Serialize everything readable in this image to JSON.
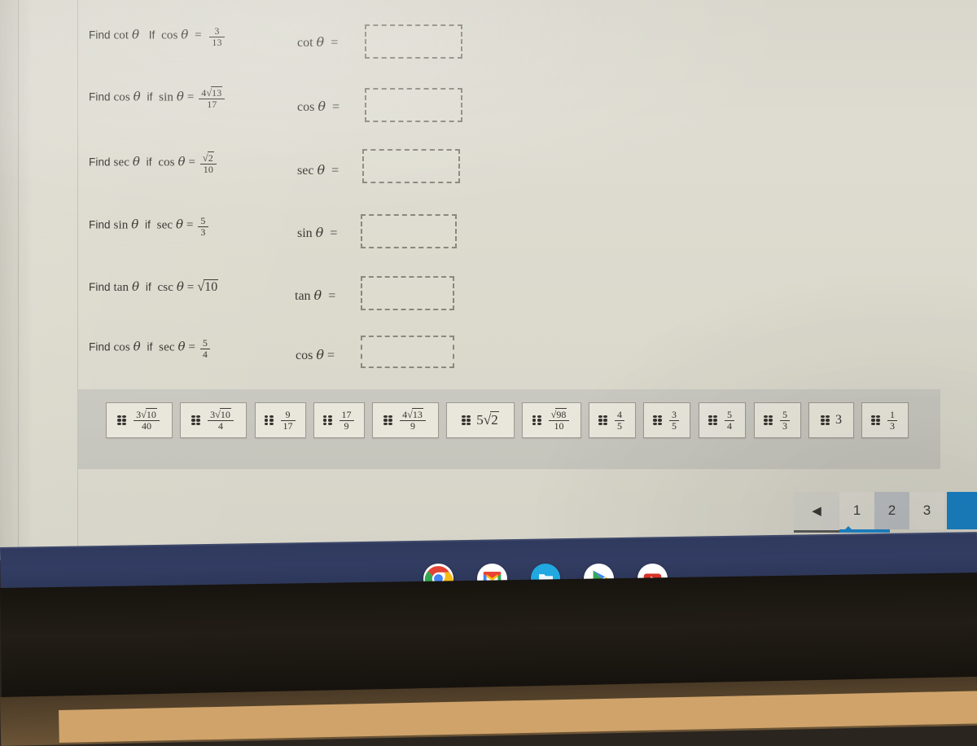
{
  "worksheet": {
    "problems": [
      {
        "prompt_find": "Find cot θ",
        "prompt_if": "If",
        "prompt_given_fn": "cos θ =",
        "given_value": "3/13",
        "answer_label": "cot θ  =",
        "answer_value": ""
      },
      {
        "prompt_find": "Find cos θ",
        "prompt_if": "if",
        "prompt_given_fn": "sin θ =",
        "given_value": "4√13/17",
        "answer_label": "cos θ  =",
        "answer_value": ""
      },
      {
        "prompt_find": "Find sec θ",
        "prompt_if": "if",
        "prompt_given_fn": "cos θ =",
        "given_value": "√2/10",
        "answer_label": "sec θ  =",
        "answer_value": ""
      },
      {
        "prompt_find": "Find sin θ",
        "prompt_if": "if",
        "prompt_given_fn": "sec θ =",
        "given_value": "5/3",
        "answer_label": "sin θ  =",
        "answer_value": ""
      },
      {
        "prompt_find": "Find tan θ",
        "prompt_if": "if",
        "prompt_given_fn": "csc θ =",
        "given_value": "√10",
        "answer_label": "tan θ  =",
        "answer_value": ""
      },
      {
        "prompt_find": "Find cos θ",
        "prompt_if": "if",
        "prompt_given_fn": "sec θ =",
        "given_value": "5/4",
        "answer_label": "cos θ =",
        "answer_value": ""
      }
    ]
  },
  "answer_bank": {
    "tiles": [
      {
        "value": "3√10/40",
        "kind": "fraction",
        "num": "3√10",
        "den": "40"
      },
      {
        "value": "3√10/4",
        "kind": "fraction",
        "num": "3√10",
        "den": "4"
      },
      {
        "value": "9/17",
        "kind": "fraction",
        "num": "9",
        "den": "17"
      },
      {
        "value": "17/9",
        "kind": "fraction",
        "num": "17",
        "den": "9"
      },
      {
        "value": "4√13/9",
        "kind": "fraction",
        "num": "4√13",
        "den": "9"
      },
      {
        "value": "5√2",
        "kind": "plain",
        "num": "5√2",
        "den": ""
      },
      {
        "value": "√98/10",
        "kind": "fraction",
        "num": "√98",
        "den": "10"
      },
      {
        "value": "4/5",
        "kind": "fraction",
        "num": "4",
        "den": "5"
      },
      {
        "value": "3/5",
        "kind": "fraction",
        "num": "3",
        "den": "5"
      },
      {
        "value": "5/4",
        "kind": "fraction",
        "num": "5",
        "den": "4"
      },
      {
        "value": "5/3",
        "kind": "fraction",
        "num": "5",
        "den": "3"
      },
      {
        "value": "3",
        "kind": "plain",
        "num": "3",
        "den": ""
      },
      {
        "value": "1/3",
        "kind": "fraction",
        "num": "1",
        "den": "3"
      }
    ]
  },
  "pagination": {
    "prev_glyph": "◀",
    "pages": [
      "1",
      "2",
      "3"
    ],
    "active_page": "2",
    "next_label": ""
  },
  "taskbar": {
    "apps": [
      {
        "name": "chrome-icon"
      },
      {
        "name": "gmail-icon"
      },
      {
        "name": "files-icon"
      },
      {
        "name": "play-store-icon"
      },
      {
        "name": "youtube-icon"
      }
    ]
  },
  "colors": {
    "accent_blue": "#1981c4",
    "shelf": "#303a5f",
    "tile_bg": "#e9e7dc",
    "paper": "#dcdacd"
  }
}
